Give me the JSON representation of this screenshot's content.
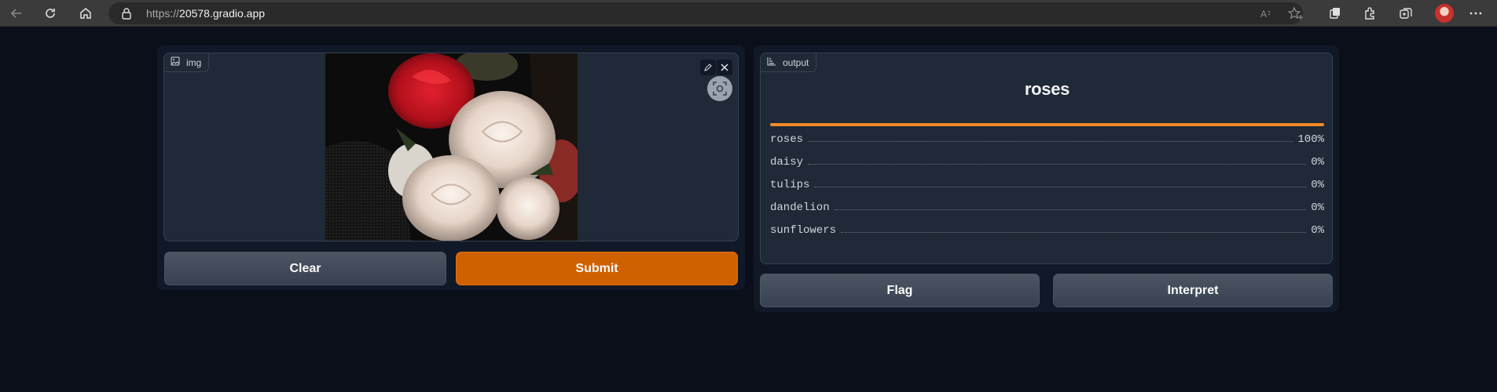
{
  "browser": {
    "url_protocol": "https://",
    "url_host": "20578.gradio.app"
  },
  "input": {
    "label": "img",
    "image_description_icon": "roses-photo"
  },
  "buttons": {
    "clear": "Clear",
    "submit": "Submit",
    "flag": "Flag",
    "interpret": "Interpret"
  },
  "output": {
    "label": "output",
    "top_label": "roses",
    "top_confidence": 1.0,
    "confidences": [
      {
        "label": "roses",
        "value": "100%"
      },
      {
        "label": "daisy",
        "value": "0%"
      },
      {
        "label": "tulips",
        "value": "0%"
      },
      {
        "label": "dandelion",
        "value": "0%"
      },
      {
        "label": "sunflowers",
        "value": "0%"
      }
    ]
  },
  "colors": {
    "background": "#0b0f19",
    "panel": "#111827",
    "block": "#1f2937",
    "primary": "#cf6100",
    "bar": "#f08a26"
  }
}
